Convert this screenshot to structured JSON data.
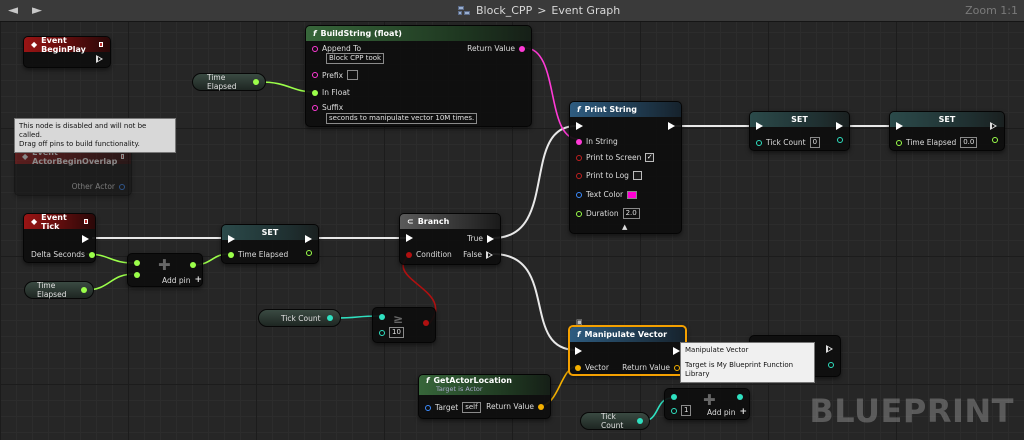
{
  "title": {
    "crumb_root": "Block_CPP",
    "separator": ">",
    "crumb_current": "Event Graph",
    "zoom": "Zoom 1:1"
  },
  "nav": {
    "back": "◄",
    "forward": "►"
  },
  "watermark": "BLUEPRINT",
  "nodes": {
    "event_beginplay": {
      "title": "Event BeginPlay"
    },
    "event_overlap": {
      "title": "Event ActorBeginOverlap",
      "pin_other": "Other Actor"
    },
    "disabled_tip": {
      "line1": "This node is disabled and will not be called.",
      "line2": "Drag off pins to build functionality."
    },
    "event_tick": {
      "title": "Event Tick",
      "pin_delta": "Delta Seconds"
    },
    "build_string": {
      "title": "BuildString (float)",
      "append_to": "Append To",
      "append_value": "Block CPP took",
      "return_value": "Return Value",
      "prefix": "Prefix",
      "in_float": "In Float",
      "suffix": "Suffix",
      "suffix_value": "seconds to manipulate vector 10M times."
    },
    "var_time_elapsed_1": {
      "label": "Time Elapsed"
    },
    "var_time_elapsed_2": {
      "label": "Time Elapsed"
    },
    "add_node_1": {
      "label": "Add pin",
      "plus": "+"
    },
    "set_time": {
      "title": "SET",
      "pin": "Time Elapsed"
    },
    "branch": {
      "title": "Branch",
      "condition": "Condition",
      "true_label": "True",
      "false_label": "False"
    },
    "print_string": {
      "title": "Print String",
      "in_string": "In String",
      "print_screen": "Print to Screen",
      "print_log": "Print to Log",
      "text_color": "Text Color",
      "duration": "Duration",
      "duration_value": "2.0",
      "screen_check": "✓"
    },
    "set_tick_count": {
      "title": "SET",
      "pin": "Tick Count",
      "value": "0"
    },
    "set_time_elapsed": {
      "title": "SET",
      "pin": "Time Elapsed",
      "value": "0.0"
    },
    "var_tick_count_1": {
      "label": "Tick Count"
    },
    "compare": {
      "value": "10"
    },
    "manipulate_vector": {
      "title": "Manipulate Vector",
      "vector": "Vector",
      "return_value": "Return Value"
    },
    "mv_tooltip": {
      "line1": "Manipulate Vector",
      "line2": "Target is My Blueprint Function Library"
    },
    "get_actor_location": {
      "title": "GetActorLocation",
      "subtitle": "Target is Actor",
      "target": "Target",
      "target_value": "self",
      "return_value": "Return Value"
    },
    "var_tick_count_2": {
      "label": "Tick Count"
    },
    "add_node_2": {
      "value": "1",
      "label": "Add pin",
      "plus": "+"
    }
  },
  "colors": {
    "exec": "#ffffff",
    "float": "#9bff4a",
    "int": "#2fe0c0",
    "string": "#ff3ad6",
    "bool": "#b01010",
    "struct": "#f4b000",
    "object": "#3c8cff",
    "selection": "#f4a000"
  }
}
